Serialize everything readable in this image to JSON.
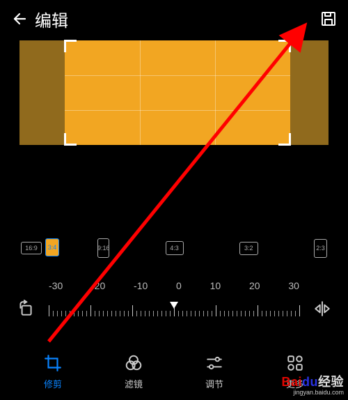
{
  "header": {
    "title": "编辑"
  },
  "icons": {
    "back": "arrow-left-icon",
    "save": "save-icon",
    "rotate": "rotate-icon",
    "mirror": "mirror-icon",
    "crop": "crop-icon",
    "filters": "filters-icon",
    "adjust": "sliders-icon",
    "more": "apps-grid-icon"
  },
  "aspect_ratios": [
    {
      "label": "16:9",
      "selected": false
    },
    {
      "label": "9:16",
      "selected": false
    },
    {
      "label": "4:3",
      "selected": false
    },
    {
      "label": "3:4",
      "selected": true
    },
    {
      "label": "3:2",
      "selected": false
    },
    {
      "label": "2:3",
      "selected": false
    }
  ],
  "ruler": {
    "labels": [
      "-30",
      "-20",
      "-10",
      "0",
      "10",
      "20",
      "30"
    ],
    "value": 0
  },
  "bottom_nav": [
    {
      "key": "crop",
      "label": "修剪",
      "active": true
    },
    {
      "key": "filters",
      "label": "滤镜",
      "active": false
    },
    {
      "key": "adjust",
      "label": "调节",
      "active": false
    },
    {
      "key": "more",
      "label": "更多",
      "active": false
    }
  ],
  "colors": {
    "accent": "#0a84ff",
    "crop_fill": "#f2a622",
    "crop_dim": "#906a1d",
    "annotation": "#ff0000"
  },
  "watermark": {
    "brand1": "Bai",
    "brand2": "du",
    "brand3": "经验",
    "sub": "jingyan.baidu.com"
  }
}
